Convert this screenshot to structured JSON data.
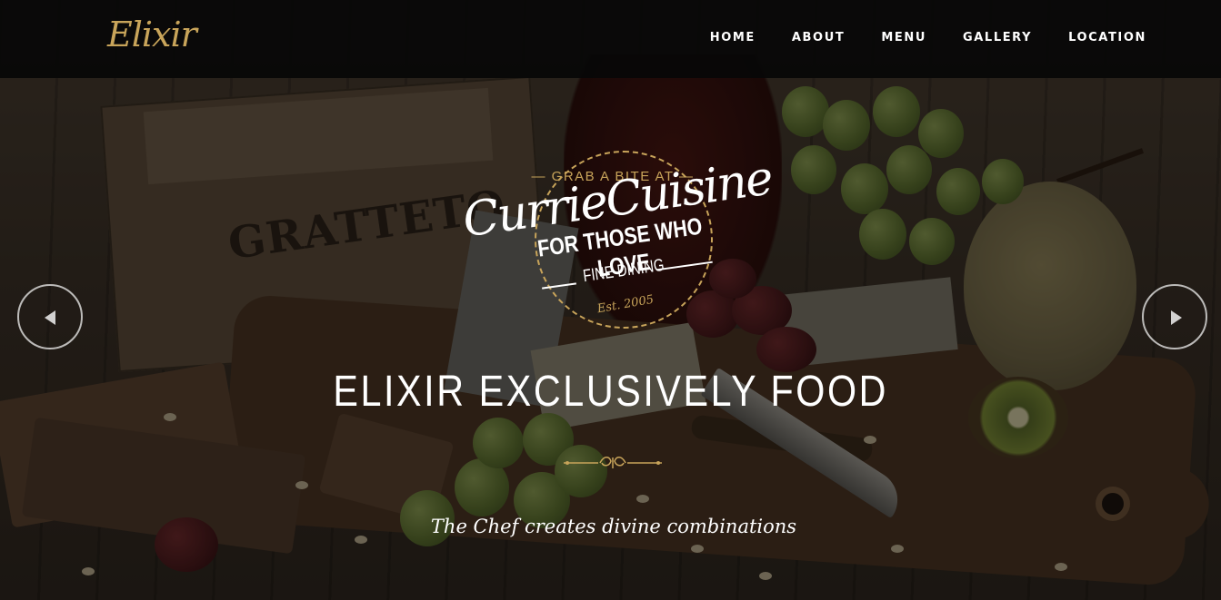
{
  "brand": {
    "logo_text": "Elixir"
  },
  "nav": {
    "items": [
      {
        "label": "HOME"
      },
      {
        "label": "ABOUT"
      },
      {
        "label": "MENU"
      },
      {
        "label": "GALLERY"
      },
      {
        "label": "LOCATION"
      }
    ]
  },
  "hero": {
    "badge": {
      "top_text": "— GRAB A BITE AT —",
      "script_text": "CurrieCuisine",
      "line1": "FOR THOSE WHO LOVE",
      "line2": "FINE DINING",
      "est": "Est. 2005"
    },
    "headline": "ELIXIR EXCLUSIVELY FOOD",
    "tagline": "The Chef creates divine combinations",
    "prev_icon": "triangle-left-icon",
    "next_icon": "triangle-right-icon"
  },
  "colors": {
    "accent_gold": "#c8a45a",
    "nav_background": "#080808",
    "text_white": "#ffffff"
  }
}
